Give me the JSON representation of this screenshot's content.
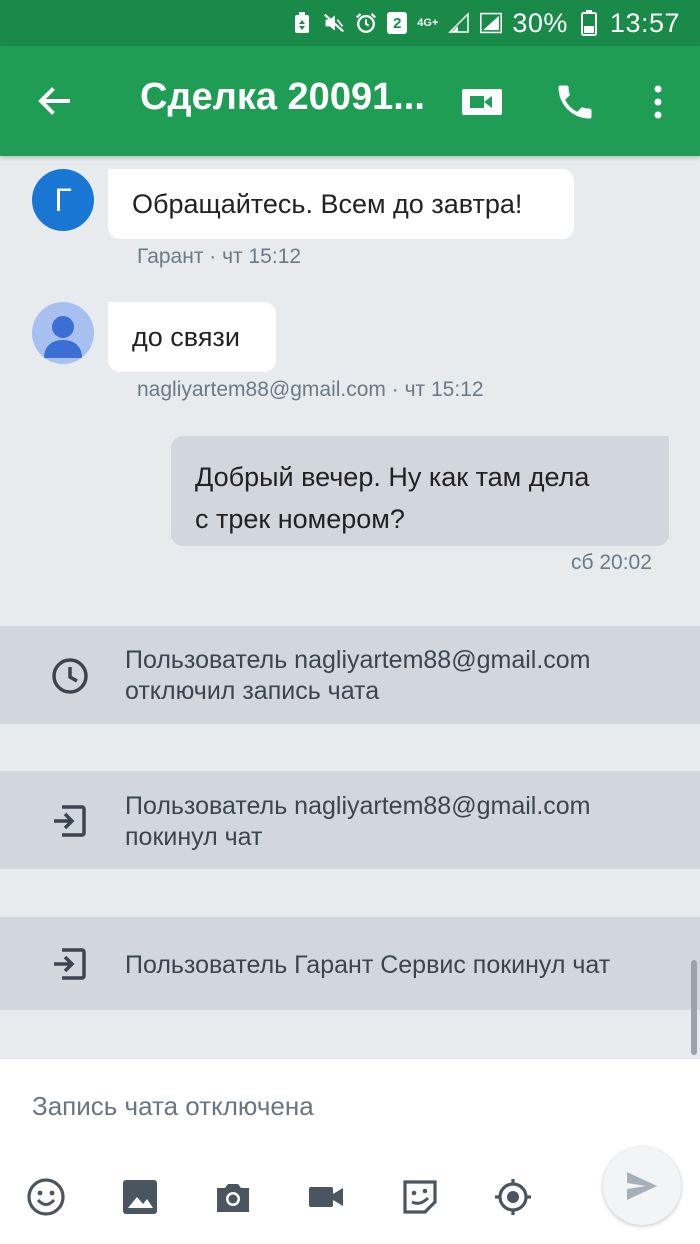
{
  "status_bar": {
    "sim_number": "2",
    "network": "4G+",
    "battery": "30%",
    "time": "13:57",
    "icons": [
      "battery-saver-icon",
      "mute-icon",
      "alarm-icon",
      "sim-icon",
      "network-4g-icon",
      "signal-icon",
      "signal-icon",
      "battery-icon"
    ]
  },
  "app_bar": {
    "title": "Сделка 20091...",
    "icons": [
      "back-arrow-icon",
      "video-call-icon",
      "phone-icon",
      "more-vert-icon"
    ]
  },
  "messages": [
    {
      "sender": "Гарант",
      "avatar_letter": "Г",
      "text": "Обращайтесь. Всем до завтра!",
      "meta": "Гарант · чт 15:12",
      "avatar_color": "#1976d2"
    },
    {
      "sender": "nagliyartem88@gmail.com",
      "text": "до связи",
      "meta": "nagliyartem88@gmail.com · чт 15:12",
      "avatar_color": "#a7c0f0"
    },
    {
      "outgoing": true,
      "line1": "Добрый вечер. Ну как там дела",
      "line2": "с трек номером?",
      "meta": "сб 20:02"
    }
  ],
  "system_events": [
    {
      "icon": "clock-icon",
      "line1": "Пользователь nagliyartem88@gmail.com",
      "line2": "отключил запись чата"
    },
    {
      "icon": "exit-icon",
      "line1": "Пользователь nagliyartem88@gmail.com",
      "line2": "покинул чат"
    },
    {
      "icon": "exit-icon",
      "line1": "Пользователь Гарант Сервис покинул чат"
    }
  ],
  "composer": {
    "placeholder": "Запись чата отключена",
    "tools": [
      "emoji-icon",
      "image-icon",
      "camera-icon",
      "video-icon",
      "sticker-icon",
      "location-icon",
      "send-icon"
    ]
  },
  "colors": {
    "status_bar": "#198a48",
    "app_bar": "#1f9d55",
    "background": "#e8ebee",
    "system_row": "#d2d7dd"
  }
}
